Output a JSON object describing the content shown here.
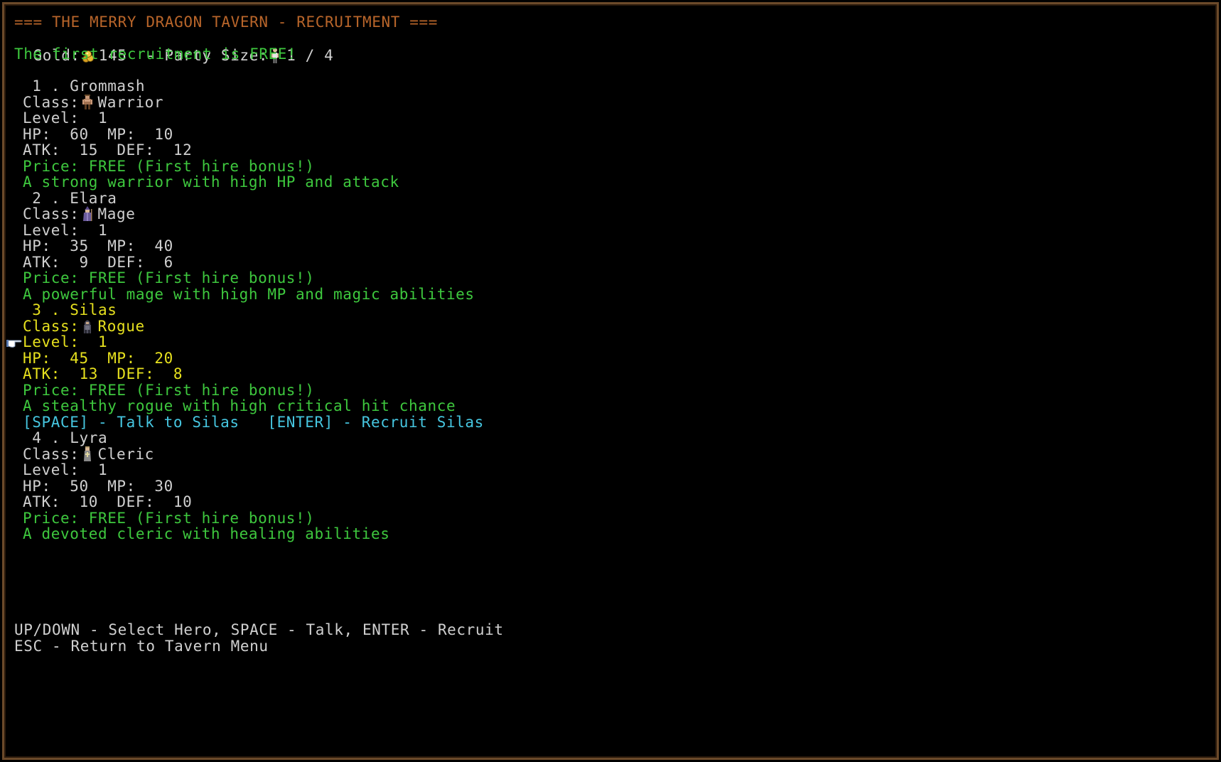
{
  "header": {
    "title": "=== THE MERRY DRAGON TAVERN - RECRUITMENT ===",
    "gold_label": "Gold:",
    "gold_value": "145",
    "party_label": "  - Party Size:",
    "party_value": "1 / 4",
    "free_notice": "The first recruitment is FREE!"
  },
  "heroes": [
    {
      "index_line": " 1 . Grommash",
      "class_label": "Class:",
      "class_name": "Warrior",
      "class_icon": "warrior-sprite-icon",
      "level_line": "Level:  1",
      "hp_mp_line": "HP:  60  MP:  10",
      "atk_def_line": "ATK:  15  DEF:  12",
      "price_line": "Price: FREE (First hire bonus!)",
      "description": "A strong warrior with high HP and attack"
    },
    {
      "index_line": " 2 . Elara",
      "class_label": "Class:",
      "class_name": "Mage",
      "class_icon": "mage-sprite-icon",
      "level_line": "Level:  1",
      "hp_mp_line": "HP:  35  MP:  40",
      "atk_def_line": "ATK:  9  DEF:  6",
      "price_line": "Price: FREE (First hire bonus!)",
      "description": "A powerful mage with high MP and magic abilities"
    },
    {
      "index_line": " 3 . Silas",
      "class_label": "Class:",
      "class_name": "Rogue",
      "class_icon": "rogue-sprite-icon",
      "level_line": "Level:  1",
      "hp_mp_line": "HP:  45  MP:  20",
      "atk_def_line": "ATK:  13  DEF:  8",
      "price_line": "Price: FREE (First hire bonus!)",
      "description": "A stealthy rogue with high critical hit chance",
      "selected": true,
      "actions": "[SPACE] - Talk to Silas   [ENTER] - Recruit Silas"
    },
    {
      "index_line": " 4 . Lyra",
      "class_label": "Class:",
      "class_name": "Cleric",
      "class_icon": "cleric-sprite-icon",
      "level_line": "Level:  1",
      "hp_mp_line": "HP:  50  MP:  30",
      "atk_def_line": "ATK:  10  DEF:  10",
      "price_line": "Price: FREE (First hire bonus!)",
      "description": "A devoted cleric with healing abilities"
    }
  ],
  "footer": {
    "controls": "UP/DOWN - Select Hero, SPACE - Talk, ENTER - Recruit",
    "escape": "ESC - Return to Tavern Menu"
  },
  "icons": {
    "gold": "coin-stack-icon",
    "party": "person-icon",
    "cursor": "pointing-hand-icon"
  },
  "colors": {
    "title": "#b8652a",
    "normal": "#d0d0d0",
    "highlight": "#3ec83e",
    "selected": "#e6e01e",
    "actions": "#46c6e0",
    "border": "#6b4a2a"
  }
}
